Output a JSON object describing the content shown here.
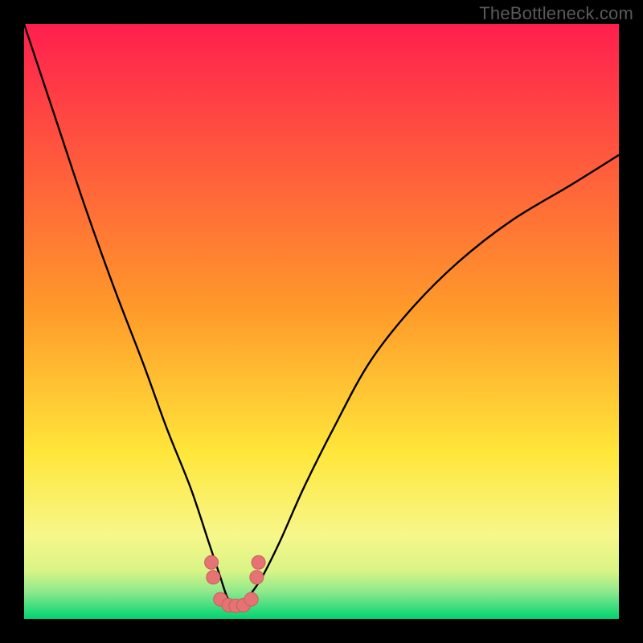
{
  "watermark": {
    "text": "TheBottleneck.com"
  },
  "colors": {
    "red_top": "#ff1f4e",
    "orange": "#ff8a2a",
    "yellow": "#ffe63a",
    "pale_yellow": "#f7f7a8",
    "green_bottom": "#00e078",
    "black": "#000000",
    "curve_stroke": "#000000",
    "marker_fill": "#e57373",
    "marker_stroke": "#cc5c5c"
  },
  "chart_data": {
    "type": "line",
    "title": "",
    "xlabel": "",
    "ylabel": "",
    "x": [
      0,
      5,
      10,
      15,
      20,
      24,
      28,
      31,
      33,
      34,
      35,
      36,
      37,
      38,
      40,
      43,
      47,
      52,
      58,
      65,
      73,
      82,
      92,
      100
    ],
    "values": [
      100,
      85,
      70,
      56,
      43,
      32,
      22,
      13,
      7,
      4,
      2,
      2,
      2,
      4,
      7,
      13,
      22,
      32,
      43,
      52,
      60,
      67,
      73,
      78
    ],
    "xlim": [
      0,
      100
    ],
    "ylim": [
      0,
      100
    ],
    "markers": {
      "x": [
        31.5,
        31.8,
        33.0,
        34.4,
        35.6,
        36.9,
        38.2,
        39.1,
        39.4
      ],
      "y": [
        9.5,
        7.0,
        3.3,
        2.3,
        2.2,
        2.3,
        3.3,
        7.0,
        9.5
      ]
    },
    "gradient_stops": [
      {
        "pos": 0.0,
        "color": "#ff1f4e"
      },
      {
        "pos": 0.48,
        "color": "#ff9a2a"
      },
      {
        "pos": 0.72,
        "color": "#ffe63a"
      },
      {
        "pos": 0.86,
        "color": "#f7f78a"
      },
      {
        "pos": 0.92,
        "color": "#d8f486"
      },
      {
        "pos": 0.955,
        "color": "#8de88c"
      },
      {
        "pos": 1.0,
        "color": "#00d472"
      }
    ]
  }
}
